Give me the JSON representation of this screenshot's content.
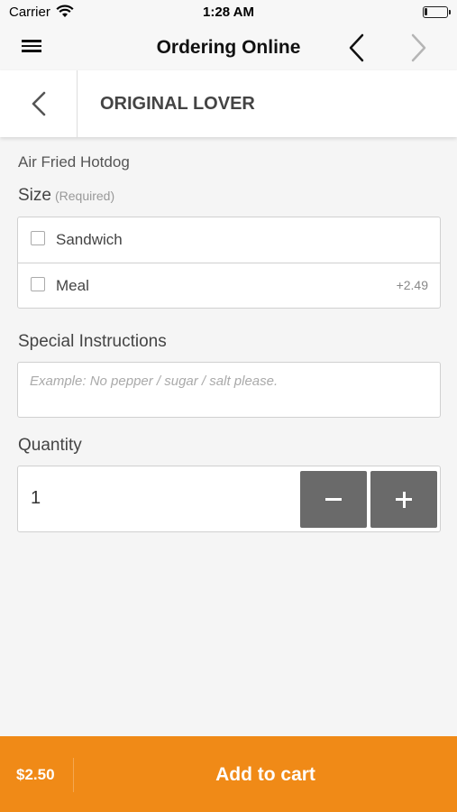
{
  "status_bar": {
    "carrier": "Carrier",
    "time": "1:28 AM"
  },
  "nav": {
    "title": "Ordering Online"
  },
  "item": {
    "title": "ORIGINAL LOVER",
    "description": "Air Fried Hotdog"
  },
  "size": {
    "label": "Size",
    "required": "(Required)",
    "options": [
      {
        "label": "Sandwich",
        "price": ""
      },
      {
        "label": "Meal",
        "price": "+2.49"
      }
    ]
  },
  "instructions": {
    "label": "Special Instructions",
    "placeholder": "Example: No pepper / sugar / salt please.",
    "value": ""
  },
  "quantity": {
    "label": "Quantity",
    "value": "1"
  },
  "footer": {
    "price": "$2.50",
    "add_label": "Add to cart"
  },
  "colors": {
    "accent": "#f08a17",
    "qty_button": "#6a6a6a"
  },
  "icons": [
    "wifi-icon",
    "battery-icon",
    "hamburger-menu-icon",
    "chevron-left-icon",
    "chevron-right-icon",
    "minus-icon",
    "plus-icon"
  ]
}
